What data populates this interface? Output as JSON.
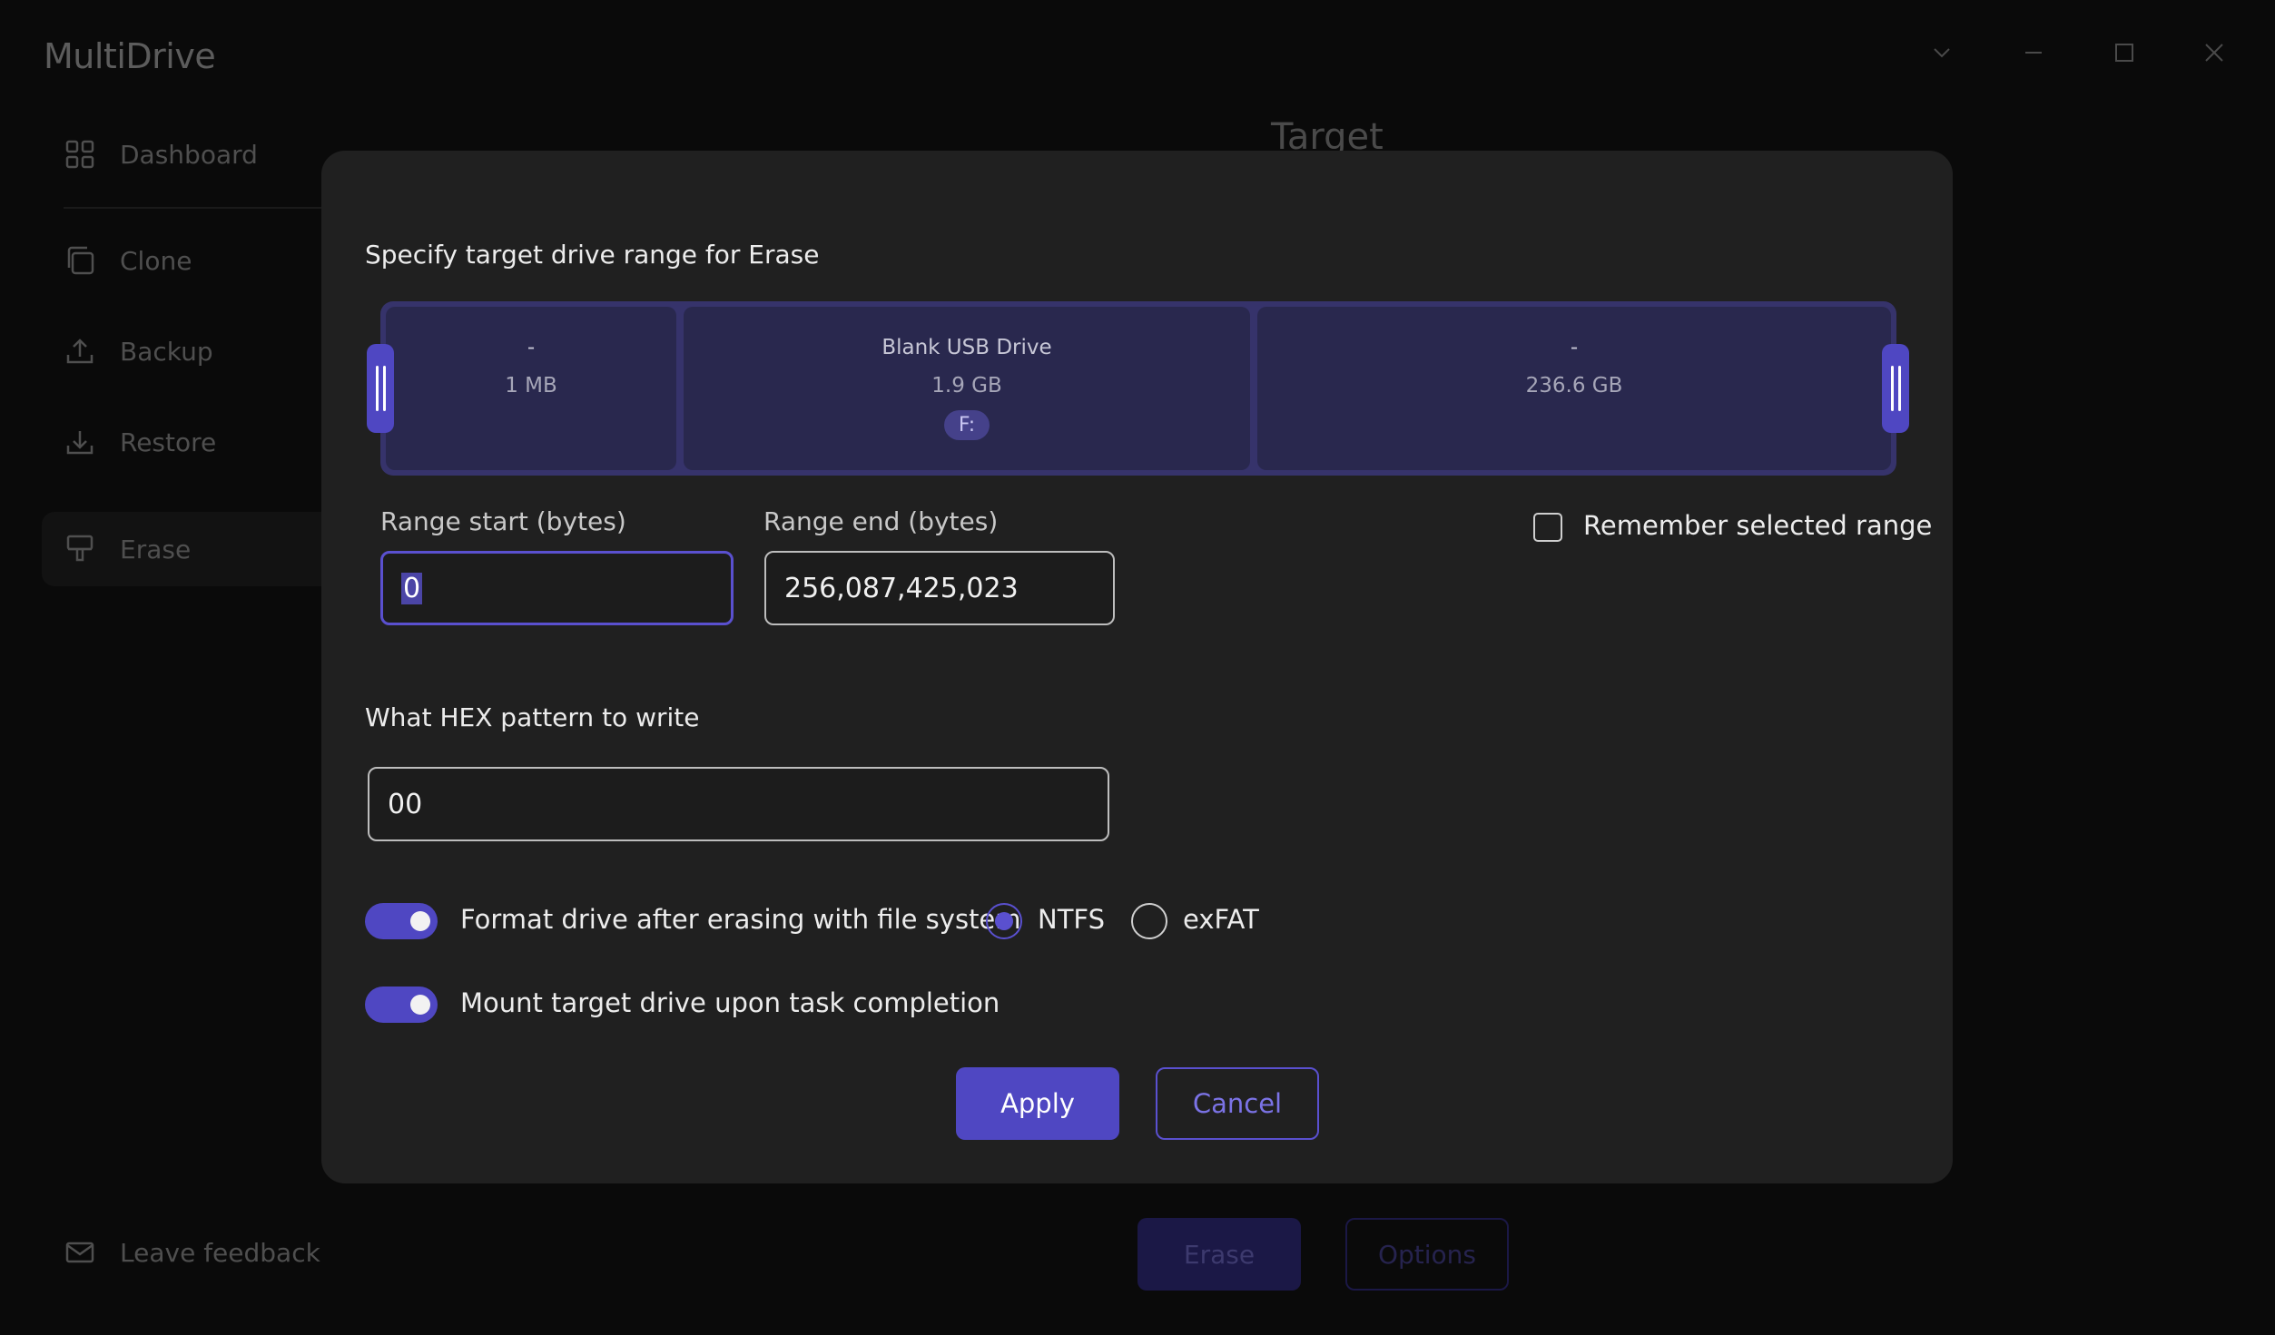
{
  "app": {
    "title": "MultiDrive"
  },
  "window_controls": [
    "chevron-down-icon",
    "minimize-icon",
    "maximize-icon",
    "close-icon"
  ],
  "sidebar": {
    "items": [
      {
        "label": "Dashboard",
        "icon": "grid-icon"
      },
      {
        "label": "Clone",
        "icon": "copy-icon"
      },
      {
        "label": "Backup",
        "icon": "upload-icon"
      },
      {
        "label": "Restore",
        "icon": "download-icon"
      },
      {
        "label": "Erase",
        "icon": "eraser-icon",
        "active": true
      }
    ],
    "feedback": {
      "label": "Leave feedback",
      "icon": "mail-icon"
    }
  },
  "background": {
    "heading": "Target",
    "erase_label": "Erase",
    "options_label": "Options"
  },
  "modal": {
    "heading": "Specify target drive range for Erase",
    "segments": [
      {
        "label": "-",
        "size": "1 MB"
      },
      {
        "label": "Blank USB Drive",
        "size": "1.9 GB",
        "letter": "F:"
      },
      {
        "label": "-",
        "size": "236.6 GB"
      }
    ],
    "range_start": {
      "label": "Range start (bytes)",
      "value": "0"
    },
    "range_end": {
      "label": "Range end (bytes)",
      "value": "256,087,425,023"
    },
    "remember": {
      "label": "Remember selected range",
      "checked": false
    },
    "hex": {
      "label": "What HEX pattern to write",
      "value": "00"
    },
    "format": {
      "label": "Format drive after erasing with file system",
      "enabled": true,
      "options": [
        {
          "label": "NTFS",
          "checked": true
        },
        {
          "label": "exFAT",
          "checked": false
        }
      ]
    },
    "mount": {
      "label": "Mount target drive upon task completion",
      "enabled": true
    },
    "apply_label": "Apply",
    "cancel_label": "Cancel"
  },
  "colors": {
    "accent": "#4f47c2",
    "modal_bg": "#202020",
    "page_bg": "#0a0a0a"
  }
}
